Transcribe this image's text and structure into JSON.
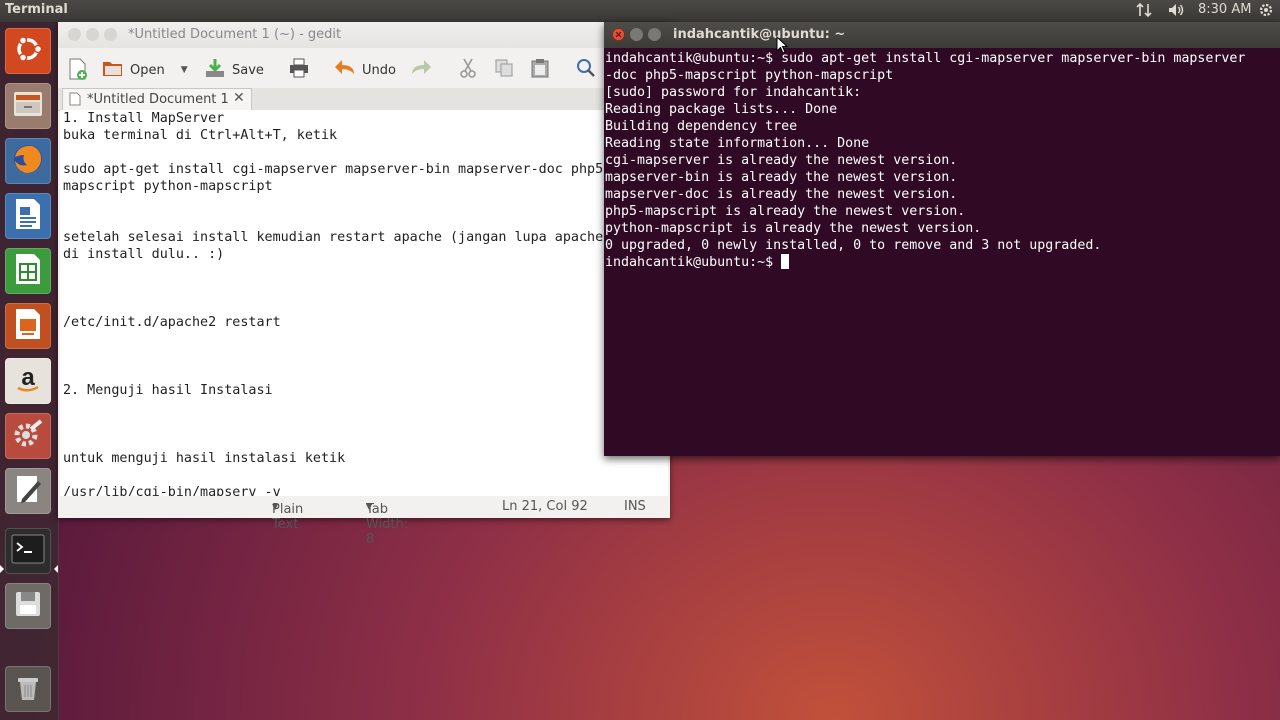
{
  "panel": {
    "title": "Terminal",
    "time": "8:30 AM"
  },
  "launcher": {
    "items": [
      {
        "name": "dash-home",
        "icon": "ubuntu-logo-icon"
      },
      {
        "name": "files",
        "icon": "file-cabinet-icon"
      },
      {
        "name": "firefox",
        "icon": "firefox-icon"
      },
      {
        "name": "writer",
        "icon": "libreoffice-writer-icon"
      },
      {
        "name": "calc",
        "icon": "libreoffice-calc-icon"
      },
      {
        "name": "impress",
        "icon": "libreoffice-impress-icon"
      },
      {
        "name": "amazon",
        "icon": "amazon-icon"
      },
      {
        "name": "system-settings",
        "icon": "settings-gear-icon"
      },
      {
        "name": "text-editor",
        "icon": "text-editor-icon"
      },
      {
        "name": "terminal",
        "icon": "terminal-icon"
      },
      {
        "name": "drive",
        "icon": "floppy-drive-icon"
      },
      {
        "name": "trash",
        "icon": "trash-icon"
      }
    ]
  },
  "gedit": {
    "window_title": "*Untitled Document 1 (~) - gedit",
    "toolbar": {
      "open": "Open",
      "save": "Save",
      "undo": "Undo"
    },
    "tab_label": "*Untitled Document 1",
    "lines": [
      "1. Install MapServer",
      "buka terminal di Ctrl+Alt+T, ketik",
      "",
      "sudo apt-get install cgi-mapserver mapserver-bin mapserver-doc php5-",
      "mapscript python-mapscript",
      "",
      "",
      "setelah selesai install kemudian restart apache (jangan lupa apache",
      "di install dulu.. :)",
      "",
      "",
      "",
      "/etc/init.d/apache2 restart",
      "",
      "",
      "",
      "2. Menguji hasil Instalasi",
      "",
      "",
      "",
      "untuk menguji hasil instalasi ketik",
      "",
      "/usr/lib/cgi-bin/mapserv -v"
    ],
    "status": {
      "language": "Plain Text",
      "tab_width": "Tab Width: 8",
      "position": "Ln 21, Col 92",
      "mode": "INS"
    }
  },
  "terminal": {
    "window_title": "indahcantik@ubuntu: ~",
    "lines": [
      "indahcantik@ubuntu:~$ sudo apt-get install cgi-mapserver mapserver-bin mapserver",
      "-doc php5-mapscript python-mapscript",
      "[sudo] password for indahcantik:",
      "Reading package lists... Done",
      "Building dependency tree",
      "Reading state information... Done",
      "cgi-mapserver is already the newest version.",
      "mapserver-bin is already the newest version.",
      "mapserver-doc is already the newest version.",
      "php5-mapscript is already the newest version.",
      "python-mapscript is already the newest version.",
      "0 upgraded, 0 newly installed, 0 to remove and 3 not upgraded."
    ],
    "prompt": "indahcantik@ubuntu:~$ "
  }
}
